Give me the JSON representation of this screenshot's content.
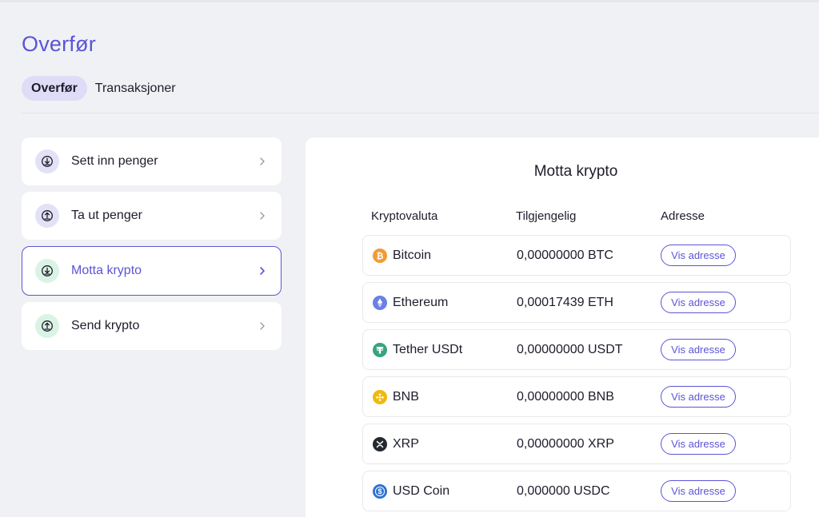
{
  "page": {
    "title": "Overfør"
  },
  "tabs": [
    {
      "label": "Overfør",
      "active": true
    },
    {
      "label": "Transaksjoner",
      "active": false
    }
  ],
  "menu": [
    {
      "label": "Sett inn penger",
      "icon": "download-icon",
      "tint": "purple"
    },
    {
      "label": "Ta ut penger",
      "icon": "upload-icon",
      "tint": "purple"
    },
    {
      "label": "Motta krypto",
      "icon": "download-icon",
      "tint": "green",
      "active": true
    },
    {
      "label": "Send krypto",
      "icon": "upload-icon",
      "tint": "green"
    }
  ],
  "panel": {
    "title": "Motta krypto",
    "columns": {
      "currency": "Kryptovaluta",
      "available": "Tilgjengelig",
      "address": "Adresse"
    },
    "rows": [
      {
        "name": "Bitcoin",
        "balance": "0,00000000 BTC",
        "button": "Vis adresse",
        "icon": "bitcoin-icon",
        "color": "#f29a33"
      },
      {
        "name": "Ethereum",
        "balance": "0,00017439 ETH",
        "button": "Vis adresse",
        "icon": "ethereum-icon",
        "color": "#6b7fe6"
      },
      {
        "name": "Tether USDt",
        "balance": "0,00000000 USDT",
        "button": "Vis adresse",
        "icon": "tether-icon",
        "color": "#3aa37f"
      },
      {
        "name": "BNB",
        "balance": "0,00000000 BNB",
        "button": "Vis adresse",
        "icon": "bnb-icon",
        "color": "#f0b90b"
      },
      {
        "name": "XRP",
        "balance": "0,00000000 XRP",
        "button": "Vis adresse",
        "icon": "xrp-icon",
        "color": "#23292f"
      },
      {
        "name": "USD Coin",
        "balance": "0,000000 USDC",
        "button": "Vis adresse",
        "icon": "usdc-icon",
        "color": "#2e72d2"
      }
    ]
  },
  "colors": {
    "accent": "#5b55d6",
    "background": "#f0f1f4"
  }
}
